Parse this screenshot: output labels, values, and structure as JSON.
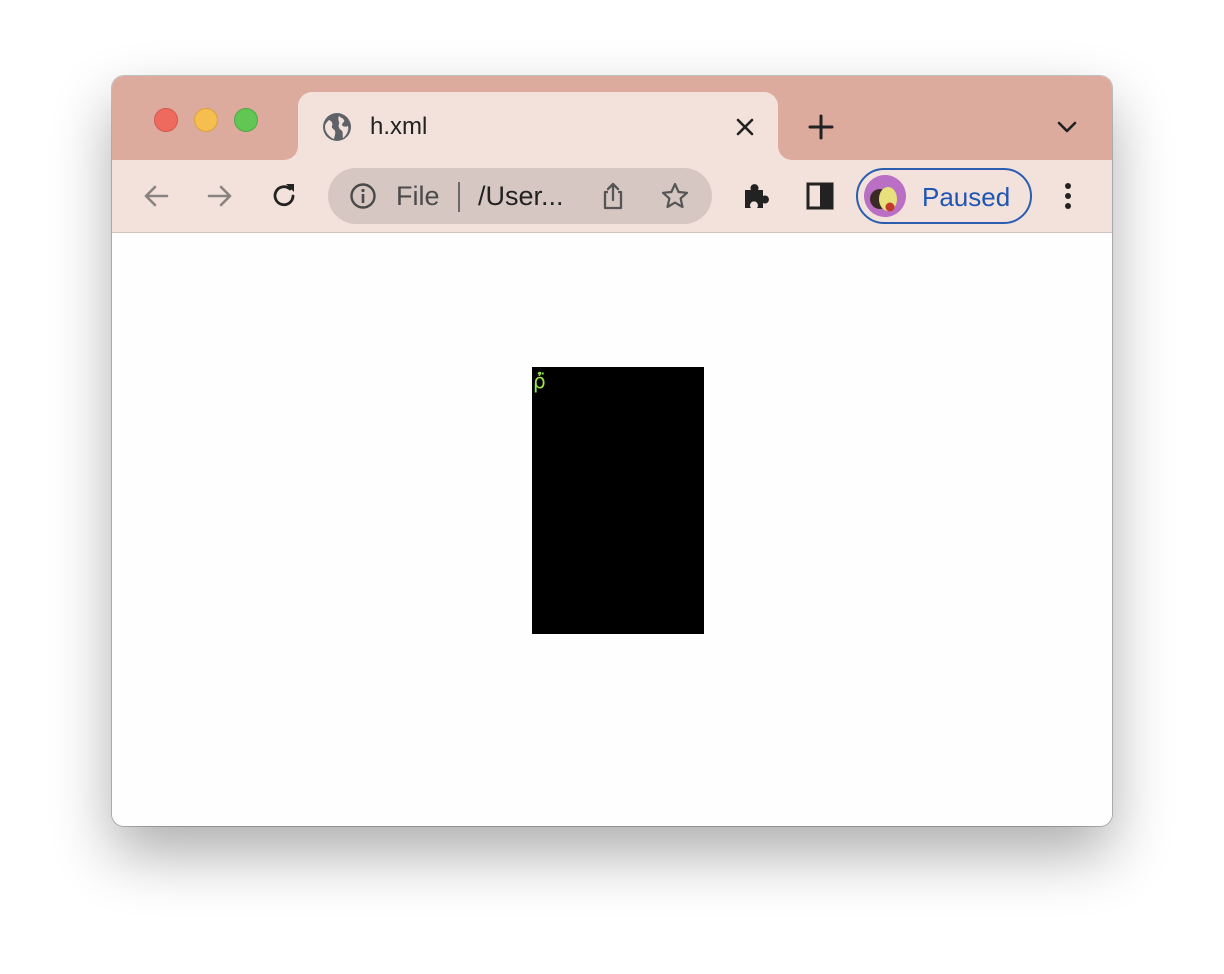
{
  "browser": {
    "tab": {
      "title": "h.xml",
      "favicon": "globe-icon"
    },
    "address_bar": {
      "scheme_label": "File",
      "url_text": "/User..."
    },
    "profile": {
      "status": "Paused"
    },
    "colors": {
      "titlebar": "#dcab9e",
      "toolbar": "#f3e2dc",
      "omnibox": "#d6c7c2",
      "profile_accent": "#1f56b3"
    }
  },
  "page": {
    "body_background": "#000000",
    "glyph": "ῤ̈",
    "glyph_color": "#9be34a"
  }
}
